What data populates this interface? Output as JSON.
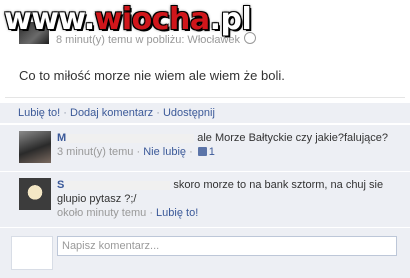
{
  "watermark": {
    "part1": "www.",
    "part2": "wiocha",
    "part3": ".pl"
  },
  "post": {
    "meta": "8 minut(y) temu w pobliżu: Włocławek",
    "text": "Co to miłość morze nie wiem ale wiem że boli."
  },
  "actions": {
    "like": "Lubię to!",
    "comment": "Dodaj komentarz",
    "share": "Udostępnij"
  },
  "comments": [
    {
      "author": "M",
      "text": "ale Morze Bałtyckie czy jakie?falujące?",
      "time": "3 minut(y) temu",
      "like_action": "Nie lubię",
      "likes": "1"
    },
    {
      "author": "S",
      "text": "skoro morze to na bank sztorm, na chuj sie glupio pytasz ?;/",
      "time": "około minuty temu",
      "like_action": "Lubię to!"
    }
  ],
  "reply": {
    "placeholder": "Napisz komentarz..."
  }
}
